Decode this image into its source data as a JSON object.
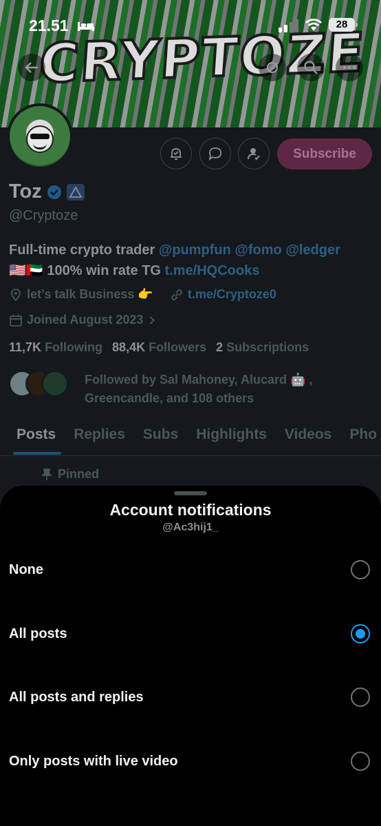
{
  "status_bar": {
    "time": "21.51",
    "battery": "28"
  },
  "banner": {
    "word": "CRYPTOZE"
  },
  "profile": {
    "display_name": "Toz",
    "handle": "@Cryptoze",
    "subscribe_label": "Subscribe",
    "bio_line1_text": "Full-time crypto trader ",
    "bio_mentions": "@pumpfun @fomo @ledger",
    "bio_line2_flags": "🇺🇸🇦🇪",
    "bio_line2_text": " 100% win rate TG ",
    "bio_line2_link": "t.me/HQCooks",
    "location": "let’s talk Business 👉",
    "website": "t.me/Cryptoze0",
    "joined": "Joined August 2023",
    "following_count": "11,7K",
    "following_label": "Following",
    "followers_count": "88,4K",
    "followers_label": "Followers",
    "subscriptions_count": "2",
    "subscriptions_label": "Subscriptions",
    "followed_by": "Followed by Sal Mahoney, Alucard 🤖 , Greencandle, and 108 others"
  },
  "tabs": [
    "Posts",
    "Replies",
    "Subs",
    "Highlights",
    "Videos",
    "Pho"
  ],
  "pinned_label": "Pinned",
  "sheet": {
    "title": "Account notifications",
    "subtitle": "@Ac3hij1_",
    "options": [
      {
        "label": "None",
        "selected": false
      },
      {
        "label": "All posts",
        "selected": true
      },
      {
        "label": "All posts and replies",
        "selected": false
      },
      {
        "label": "Only posts with live video",
        "selected": false
      }
    ]
  },
  "colors": {
    "accent": "#1d9bf0",
    "subscribe_bg": "#5e2845",
    "sheet_bg": "#000000"
  }
}
